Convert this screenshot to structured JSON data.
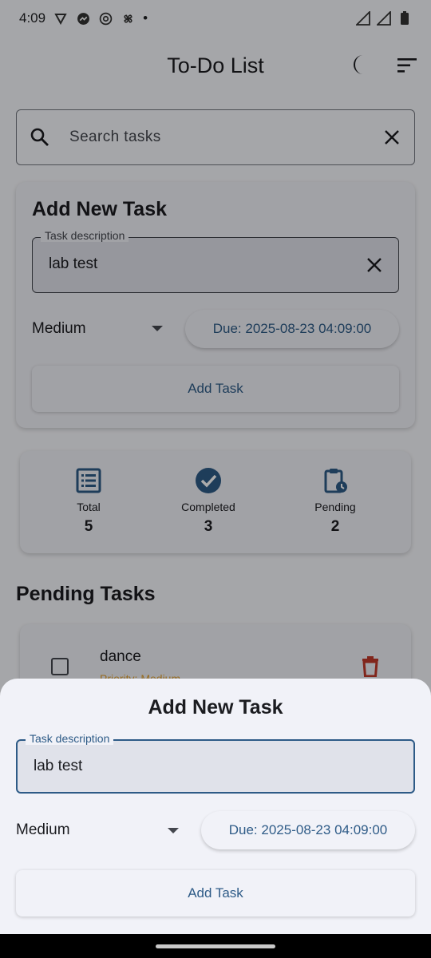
{
  "status_bar": {
    "time": "4:09",
    "dot": "•"
  },
  "app_bar": {
    "title": "To-Do List"
  },
  "search": {
    "placeholder": "Search tasks"
  },
  "add_card": {
    "title": "Add New Task",
    "desc_label": "Task description",
    "desc_value": "lab test",
    "priority": "Medium",
    "due": "Due: 2025-08-23 04:09:00",
    "add_button": "Add Task"
  },
  "stats": {
    "total_label": "Total",
    "total_value": "5",
    "completed_label": "Completed",
    "completed_value": "3",
    "pending_label": "Pending",
    "pending_value": "2"
  },
  "pending_section": {
    "title": "Pending Tasks"
  },
  "tasks": [
    {
      "title": "dance",
      "priority": "Priority: Medium"
    }
  ],
  "sheet": {
    "title": "Add New Task",
    "desc_label": "Task description",
    "desc_value": "lab test",
    "priority": "Medium",
    "due": "Due: 2025-08-23 04:09:00",
    "add_button": "Add Task"
  },
  "colors": {
    "accent": "#2e5b87",
    "delete": "#c0392b",
    "priority_medium": "#e0a030"
  }
}
